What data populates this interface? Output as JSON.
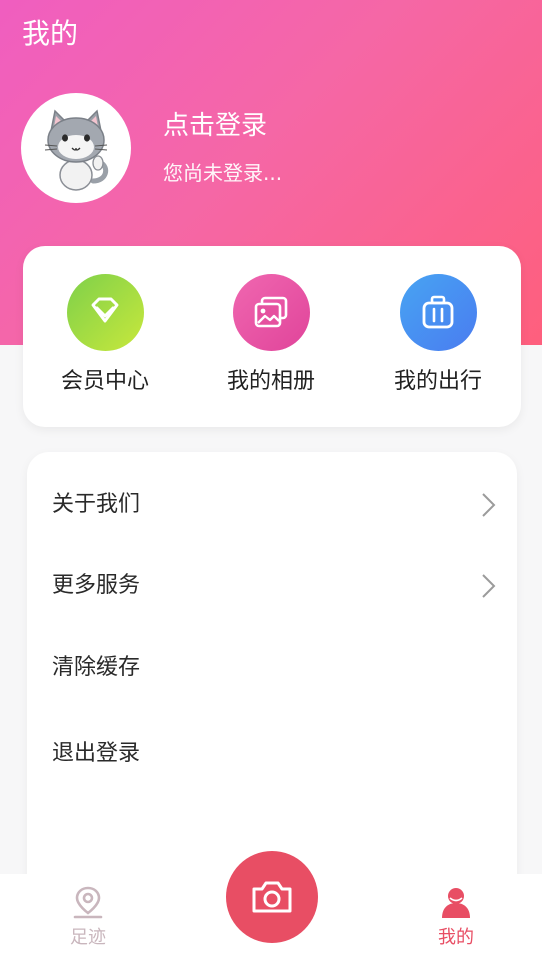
{
  "header": {
    "title": "我的",
    "login_title": "点击登录",
    "login_subtitle": "您尚未登录..."
  },
  "quick_actions": [
    {
      "label": "会员中心",
      "icon": "diamond-icon"
    },
    {
      "label": "我的相册",
      "icon": "album-icon"
    },
    {
      "label": "我的出行",
      "icon": "suitcase-icon"
    }
  ],
  "menu": [
    {
      "label": "关于我们",
      "has_arrow": true
    },
    {
      "label": "更多服务",
      "has_arrow": true
    },
    {
      "label": "清除缓存",
      "has_arrow": false
    },
    {
      "label": "退出登录",
      "has_arrow": false
    }
  ],
  "tabbar": {
    "left_label": "足迹",
    "right_label": "我的",
    "active_color": "#e84e64",
    "inactive_color": "#c9b6bd"
  },
  "colors": {
    "brand": "#e84e64",
    "header_start": "#f05ec0",
    "header_end": "#fe5f7d"
  }
}
